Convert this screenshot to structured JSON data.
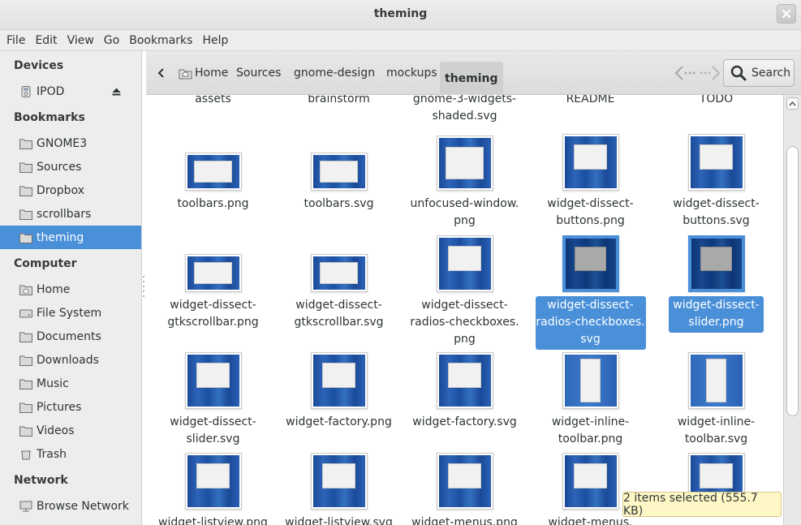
{
  "window": {
    "title": "theming"
  },
  "menu": [
    "File",
    "Edit",
    "View",
    "Go",
    "Bookmarks",
    "Help"
  ],
  "sidebar": {
    "sections": [
      {
        "heading": "Devices",
        "items": [
          {
            "label": "IPOD",
            "icon": "ipod-icon",
            "eject": true
          }
        ]
      },
      {
        "heading": "Bookmarks",
        "items": [
          {
            "label": "GNOME3",
            "icon": "folder-icon"
          },
          {
            "label": "Sources",
            "icon": "folder-icon"
          },
          {
            "label": "Dropbox",
            "icon": "folder-icon"
          },
          {
            "label": "scrollbars",
            "icon": "folder-icon"
          },
          {
            "label": "theming",
            "icon": "folder-icon",
            "selected": true
          }
        ]
      },
      {
        "heading": "Computer",
        "items": [
          {
            "label": "Home",
            "icon": "home-icon"
          },
          {
            "label": "File System",
            "icon": "drive-icon"
          },
          {
            "label": "Documents",
            "icon": "folder-icon"
          },
          {
            "label": "Downloads",
            "icon": "folder-icon"
          },
          {
            "label": "Music",
            "icon": "folder-icon"
          },
          {
            "label": "Pictures",
            "icon": "folder-icon"
          },
          {
            "label": "Videos",
            "icon": "folder-icon"
          },
          {
            "label": "Trash",
            "icon": "trash-icon"
          }
        ]
      },
      {
        "heading": "Network",
        "items": [
          {
            "label": "Browse Network",
            "icon": "network-icon"
          }
        ]
      }
    ]
  },
  "toolbar": {
    "breadcrumbs": [
      "Home",
      "Sources",
      "gnome-design",
      "mockups",
      "theming"
    ],
    "active_crumb": "theming",
    "search_label": "Search"
  },
  "files": [
    {
      "name": [
        "assets"
      ]
    },
    {
      "name": [
        "brainstorm"
      ]
    },
    {
      "name": [
        "gnome-3-widgets-",
        "shaded.svg"
      ]
    },
    {
      "name": [
        "README"
      ]
    },
    {
      "name": [
        "TODO"
      ]
    },
    {
      "name": [
        "toolbars.png"
      ],
      "thumb": "wide"
    },
    {
      "name": [
        "toolbars.svg"
      ],
      "thumb": "wide"
    },
    {
      "name": [
        "unfocused-window.",
        "png"
      ],
      "thumb": "wide-dark"
    },
    {
      "name": [
        "widget-dissect-",
        "buttons.png"
      ],
      "thumb": "tall"
    },
    {
      "name": [
        "widget-dissect-",
        "buttons.svg"
      ],
      "thumb": "tall"
    },
    {
      "name": [
        "widget-dissect-",
        "gtkscrollbar.png"
      ],
      "thumb": "wide-small"
    },
    {
      "name": [
        "widget-dissect-",
        "gtkscrollbar.svg"
      ],
      "thumb": "wide-small"
    },
    {
      "name": [
        "widget-dissect-",
        "radios-checkboxes.",
        "png"
      ],
      "thumb": "tall"
    },
    {
      "name": [
        "widget-dissect-",
        "radios-checkboxes.",
        "svg"
      ],
      "thumb": "tall",
      "selected": true
    },
    {
      "name": [
        "widget-dissect-",
        "slider.png"
      ],
      "thumb": "tall",
      "selected": true
    },
    {
      "name": [
        "widget-dissect-",
        "slider.svg"
      ],
      "thumb": "tall"
    },
    {
      "name": [
        "widget-factory.png"
      ],
      "thumb": "tall"
    },
    {
      "name": [
        "widget-factory.svg"
      ],
      "thumb": "tall"
    },
    {
      "name": [
        "widget-inline-",
        "toolbar.png"
      ],
      "thumb": "tall-light"
    },
    {
      "name": [
        "widget-inline-",
        "toolbar.svg"
      ],
      "thumb": "tall-light"
    },
    {
      "name": [
        "widget-listview.png"
      ],
      "thumb": "tall"
    },
    {
      "name": [
        "widget-listview.svg"
      ],
      "thumb": "tall"
    },
    {
      "name": [
        "widget-menus.png"
      ],
      "thumb": "tall"
    },
    {
      "name": [
        "widget-menus."
      ],
      "thumb": "tall"
    },
    {
      "name": [
        ""
      ],
      "thumb": "tall"
    }
  ],
  "status": {
    "text": "2 items selected (555.7 KB)"
  },
  "colors": {
    "accent": "#4a90d9",
    "status_bg": "#fff8c6"
  }
}
